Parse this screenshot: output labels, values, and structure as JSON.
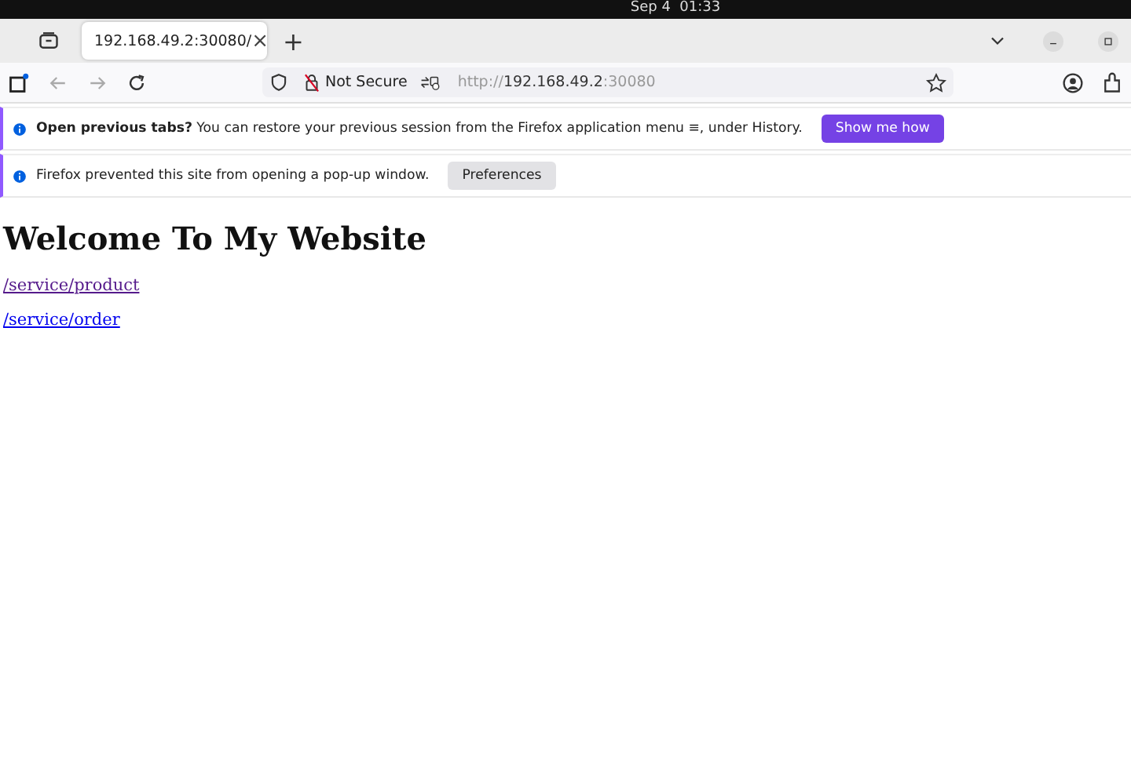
{
  "system_bar": {
    "clock": "Sep 4  01:33"
  },
  "tabs": [
    {
      "title": "192.168.49.2:30080/",
      "selected": true,
      "close": "×"
    }
  ],
  "new_tab": "+",
  "address_bar": {
    "security": "Not Secure",
    "url_scheme": "http://",
    "url_host": "192.168.49.2",
    "url_port": ":30080"
  },
  "notifications": [
    {
      "kind": "action",
      "message": "**Open previous tabs?** You can restore your previous session from the Firefox application menu ≡, under History.",
      "button": "Show me how"
    },
    {
      "kind": "secondary",
      "message": "Firefox prevented this site from opening a pop-up window.",
      "button": "Preferences"
    }
  ],
  "page": {
    "heading": "Welcome To My Website",
    "links": [
      {
        "text": "/service/product",
        "visited": true
      },
      {
        "text": "/service/order",
        "visited": false
      }
    ]
  }
}
